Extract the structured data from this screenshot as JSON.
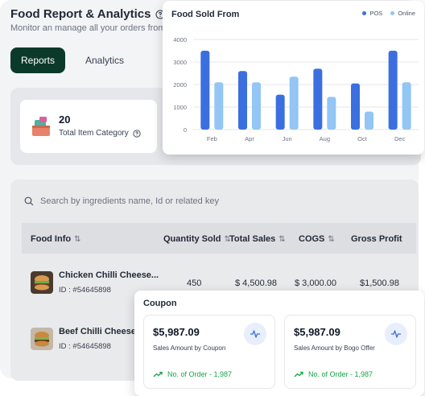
{
  "header": {
    "title": "Food Report & Analytics",
    "subtitle": "Monitor an manage all your orders from"
  },
  "tabs": [
    {
      "label": "Reports",
      "active": true
    },
    {
      "label": "Analytics",
      "active": false
    }
  ],
  "category_card": {
    "value": "20",
    "label": "Total Item Category"
  },
  "search": {
    "placeholder": "Search by ingredients name, Id or related key"
  },
  "table": {
    "columns": [
      "Food Info",
      "Quantity Sold",
      "Total Sales",
      "COGS",
      "Gross Profit"
    ],
    "rows": [
      {
        "name": "Chicken Chilli Cheese...",
        "id": "ID : #54645898",
        "quantity": "450",
        "total_sales": "$ 4,500.98",
        "cogs": "$ 3,000.00",
        "gross_profit": "$1,500.98"
      },
      {
        "name": "Beef Chilli Cheese B",
        "id": "ID : #54645898"
      }
    ]
  },
  "chart_panel": {
    "legend": [
      {
        "label": "POS",
        "color": "#3b6fe0"
      },
      {
        "label": "Online",
        "color": "#93c5f5"
      }
    ]
  },
  "chart_data": {
    "type": "bar",
    "title": "Food Sold From",
    "categories": [
      "Feb",
      "Apr",
      "Jun",
      "Aug",
      "Oct",
      "Dec"
    ],
    "series": [
      {
        "name": "POS",
        "color": "#3b6fe0",
        "values": [
          3500,
          2600,
          1550,
          2700,
          2050,
          3500
        ]
      },
      {
        "name": "Online",
        "color": "#93c5f5",
        "values": [
          2100,
          2100,
          2350,
          1450,
          800,
          2100
        ]
      }
    ],
    "ylim": [
      0,
      4000
    ],
    "yticks": [
      "0",
      "1000",
      "2000",
      "3000",
      "4000"
    ],
    "grid": true,
    "legend_position": "top-right"
  },
  "coupon": {
    "title": "Coupon",
    "cards": [
      {
        "amount": "$5,987.09",
        "label": "Sales Amount by Coupon",
        "orders": "No. of Order - 1,987"
      },
      {
        "amount": "$5,987.09",
        "label": "Sales Amount by Bogo Offer",
        "orders": "No. of Order - 1,987"
      }
    ]
  }
}
